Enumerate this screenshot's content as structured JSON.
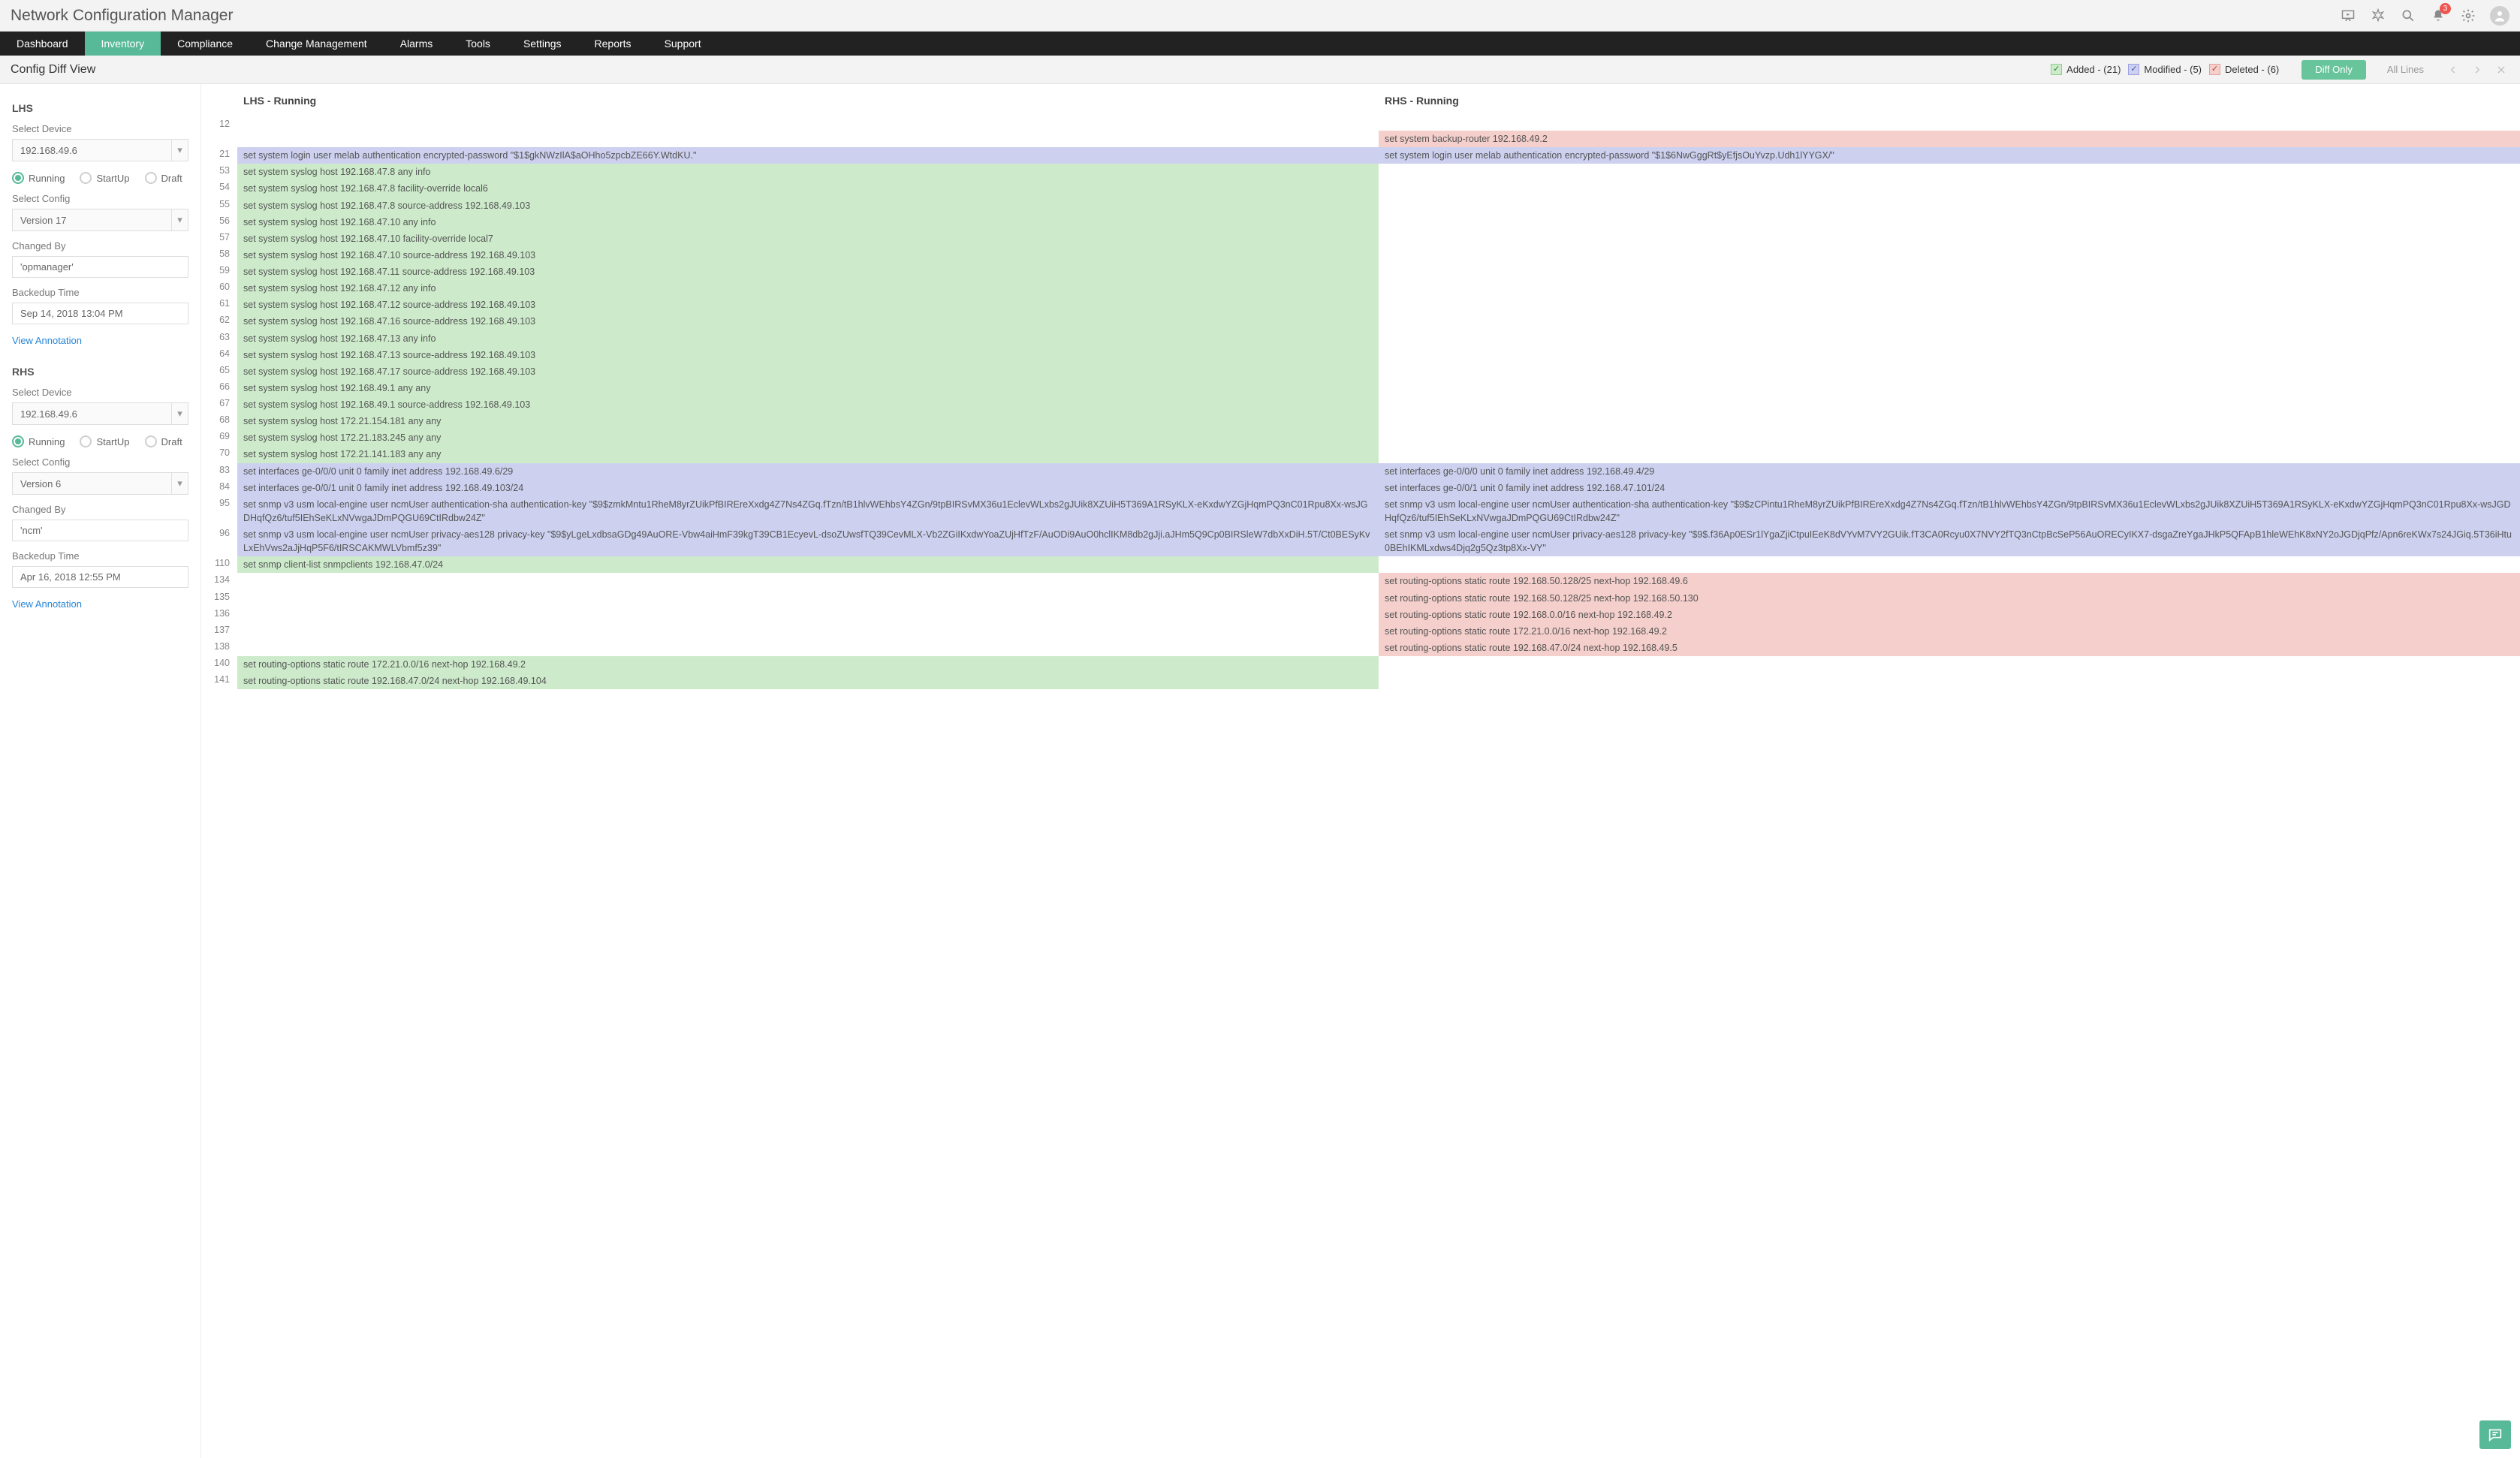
{
  "appTitle": "Network Configuration Manager",
  "notificationCount": "3",
  "nav": [
    "Dashboard",
    "Inventory",
    "Compliance",
    "Change Management",
    "Alarms",
    "Tools",
    "Settings",
    "Reports",
    "Support"
  ],
  "navActive": 1,
  "pageTitle": "Config Diff View",
  "legend": {
    "added": "Added - (21)",
    "modified": "Modified - (5)",
    "deleted": "Deleted - (6)"
  },
  "modeButtons": {
    "diffOnly": "Diff Only",
    "allLines": "All Lines"
  },
  "lhs": {
    "title": "LHS",
    "selectDeviceLabel": "Select Device",
    "device": "192.168.49.6",
    "radios": [
      "Running",
      "StartUp",
      "Draft"
    ],
    "radioSelected": 0,
    "selectConfigLabel": "Select Config",
    "config": "Version 17",
    "changedByLabel": "Changed By",
    "changedBy": "'opmanager'",
    "backedupLabel": "Backedup Time",
    "backedup": "Sep 14, 2018 13:04 PM",
    "viewAnnotation": "View Annotation"
  },
  "rhs": {
    "title": "RHS",
    "selectDeviceLabel": "Select Device",
    "device": "192.168.49.6",
    "radios": [
      "Running",
      "StartUp",
      "Draft"
    ],
    "radioSelected": 0,
    "selectConfigLabel": "Select Config",
    "config": "Version 6",
    "changedByLabel": "Changed By",
    "changedBy": "'ncm'",
    "backedupLabel": "Backedup Time",
    "backedup": "Apr 16, 2018 12:55 PM",
    "viewAnnotation": "View Annotation"
  },
  "diffHeaders": {
    "lhs": "LHS - Running",
    "rhs": "RHS - Running"
  },
  "diffRows": [
    {
      "ln": "",
      "lhs": "",
      "ltype": "",
      "rhs": "set system backup-router 192.168.49.2",
      "rtype": "deleted"
    },
    {
      "ln": "21",
      "lhs": "set system login user melab authentication encrypted-password \"$1$gkNWzIlA$aOHho5zpcbZE66Y.WtdKU.\"",
      "ltype": "modified",
      "rhs": "set system login user melab authentication encrypted-password \"$1$6NwGggRt$yEfjsOuYvzp.Udh1lYYGX/\"",
      "rtype": "modified"
    },
    {
      "ln": "53",
      "lhs": "set system syslog host 192.168.47.8 any info",
      "ltype": "added",
      "rhs": "",
      "rtype": ""
    },
    {
      "ln": "54",
      "lhs": "set system syslog host 192.168.47.8 facility-override local6",
      "ltype": "added",
      "rhs": "",
      "rtype": ""
    },
    {
      "ln": "55",
      "lhs": "set system syslog host 192.168.47.8 source-address 192.168.49.103",
      "ltype": "added",
      "rhs": "",
      "rtype": ""
    },
    {
      "ln": "56",
      "lhs": "set system syslog host 192.168.47.10 any info",
      "ltype": "added",
      "rhs": "",
      "rtype": ""
    },
    {
      "ln": "57",
      "lhs": "set system syslog host 192.168.47.10 facility-override local7",
      "ltype": "added",
      "rhs": "",
      "rtype": ""
    },
    {
      "ln": "58",
      "lhs": "set system syslog host 192.168.47.10 source-address 192.168.49.103",
      "ltype": "added",
      "rhs": "",
      "rtype": ""
    },
    {
      "ln": "59",
      "lhs": "set system syslog host 192.168.47.11 source-address 192.168.49.103",
      "ltype": "added",
      "rhs": "",
      "rtype": ""
    },
    {
      "ln": "60",
      "lhs": "set system syslog host 192.168.47.12 any info",
      "ltype": "added",
      "rhs": "",
      "rtype": ""
    },
    {
      "ln": "61",
      "lhs": "set system syslog host 192.168.47.12 source-address 192.168.49.103",
      "ltype": "added",
      "rhs": "",
      "rtype": ""
    },
    {
      "ln": "62",
      "lhs": "set system syslog host 192.168.47.16 source-address 192.168.49.103",
      "ltype": "added",
      "rhs": "",
      "rtype": ""
    },
    {
      "ln": "63",
      "lhs": "set system syslog host 192.168.47.13 any info",
      "ltype": "added",
      "rhs": "",
      "rtype": ""
    },
    {
      "ln": "64",
      "lhs": "set system syslog host 192.168.47.13 source-address 192.168.49.103",
      "ltype": "added",
      "rhs": "",
      "rtype": ""
    },
    {
      "ln": "65",
      "lhs": "set system syslog host 192.168.47.17 source-address 192.168.49.103",
      "ltype": "added",
      "rhs": "",
      "rtype": ""
    },
    {
      "ln": "66",
      "lhs": "set system syslog host 192.168.49.1 any any",
      "ltype": "added",
      "rhs": "",
      "rtype": ""
    },
    {
      "ln": "67",
      "lhs": "set system syslog host 192.168.49.1 source-address 192.168.49.103",
      "ltype": "added",
      "rhs": "",
      "rtype": ""
    },
    {
      "ln": "68",
      "lhs": "set system syslog host 172.21.154.181 any any",
      "ltype": "added",
      "rhs": "",
      "rtype": ""
    },
    {
      "ln": "69",
      "lhs": "set system syslog host 172.21.183.245 any any",
      "ltype": "added",
      "rhs": "",
      "rtype": ""
    },
    {
      "ln": "70",
      "lhs": "set system syslog host 172.21.141.183 any any",
      "ltype": "added",
      "rhs": "",
      "rtype": ""
    },
    {
      "ln": "83",
      "lhs": "set interfaces ge-0/0/0 unit 0 family inet address 192.168.49.6/29",
      "ltype": "modified",
      "rhs": "set interfaces ge-0/0/0 unit 0 family inet address 192.168.49.4/29",
      "rtype": "modified"
    },
    {
      "ln": "84",
      "lhs": "set interfaces ge-0/0/1 unit 0 family inet address 192.168.49.103/24",
      "ltype": "modified",
      "rhs": "set interfaces ge-0/0/1 unit 0 family inet address 192.168.47.101/24",
      "rtype": "modified"
    },
    {
      "ln": "95",
      "lhs": "set snmp v3 usm local-engine user ncmUser authentication-sha authentication-key \"$9$zmkMntu1RheM8yrZUikPfBIREreXxdg4Z7Ns4ZGq.fTzn/tB1hlvWEhbsY4ZGn/9tpBIRSvMX36u1EclevWLxbs2gJUik8XZUiH5T369A1RSyKLX-eKxdwYZGjHqmPQ3nC01Rpu8Xx-wsJGDHqfQz6/tuf5IEhSeKLxNVwgaJDmPQGU69CtIRdbw24Z\"",
      "ltype": "modified",
      "rhs": "set snmp v3 usm local-engine user ncmUser authentication-sha authentication-key \"$9$zCPintu1RheM8yrZUikPfBIREreXxdg4Z7Ns4ZGq.fTzn/tB1hlvWEhbsY4ZGn/9tpBIRSvMX36u1EclevWLxbs2gJUik8XZUiH5T369A1RSyKLX-eKxdwYZGjHqmPQ3nC01Rpu8Xx-wsJGDHqfQz6/tuf5IEhSeKLxNVwgaJDmPQGU69CtIRdbw24Z\"",
      "rtype": "modified"
    },
    {
      "ln": "96",
      "lhs": "set snmp v3 usm local-engine user ncmUser privacy-aes128 privacy-key \"$9$yLgeLxdbsaGDg49AuORE-Vbw4aiHmF39kgT39CB1EcyevL-dsoZUwsfTQ39CevMLX-Vb2ZGiIKxdwYoaZUjHfTzF/AuODi9AuO0hclIKM8db2gJji.aJHm5Q9Cp0BIRSleW7dbXxDiH.5T/Ct0BESyKvLxEhVws2aJjHqP5F6/tIRSCAKMWLVbmf5z39\"",
      "ltype": "modified",
      "rhs": "set snmp v3 usm local-engine user ncmUser privacy-aes128 privacy-key \"$9$.f36Ap0ESr1lYgaZjiCtpuIEeK8dVYvM7VY2GUik.fT3CA0Rcyu0X7NVY2fTQ3nCtpBcSeP56AuORECyIKX7-dsgaZreYgaJHkP5QFApB1hleWEhK8xNY2oJGDjqPfz/Apn6reKWx7s24JGiq.5T36iHtu0BEhIKMLxdws4Djq2g5Qz3tp8Xx-VY\"",
      "rtype": "modified"
    },
    {
      "ln": "110",
      "lhs": "set snmp client-list snmpclients 192.168.47.0/24",
      "ltype": "added",
      "rhs": "",
      "rtype": ""
    },
    {
      "ln": "134",
      "lhs": "",
      "ltype": "",
      "rhs": "set routing-options static route 192.168.50.128/25 next-hop 192.168.49.6",
      "rtype": "deleted"
    },
    {
      "ln": "135",
      "lhs": "",
      "ltype": "",
      "rhs": "set routing-options static route 192.168.50.128/25 next-hop 192.168.50.130",
      "rtype": "deleted"
    },
    {
      "ln": "136",
      "lhs": "",
      "ltype": "",
      "rhs": "set routing-options static route 192.168.0.0/16 next-hop 192.168.49.2",
      "rtype": "deleted"
    },
    {
      "ln": "137",
      "lhs": "",
      "ltype": "",
      "rhs": "set routing-options static route 172.21.0.0/16 next-hop 192.168.49.2",
      "rtype": "deleted"
    },
    {
      "ln": "138",
      "lhs": "",
      "ltype": "",
      "rhs": "set routing-options static route 192.168.47.0/24 next-hop 192.168.49.5",
      "rtype": "deleted"
    },
    {
      "ln": "140",
      "lhs": "set routing-options static route 172.21.0.0/16 next-hop 192.168.49.2",
      "ltype": "added",
      "rhs": "",
      "rtype": ""
    },
    {
      "ln": "141",
      "lhs": "set routing-options static route 192.168.47.0/24 next-hop 192.168.49.104",
      "ltype": "added",
      "rhs": "",
      "rtype": ""
    }
  ]
}
